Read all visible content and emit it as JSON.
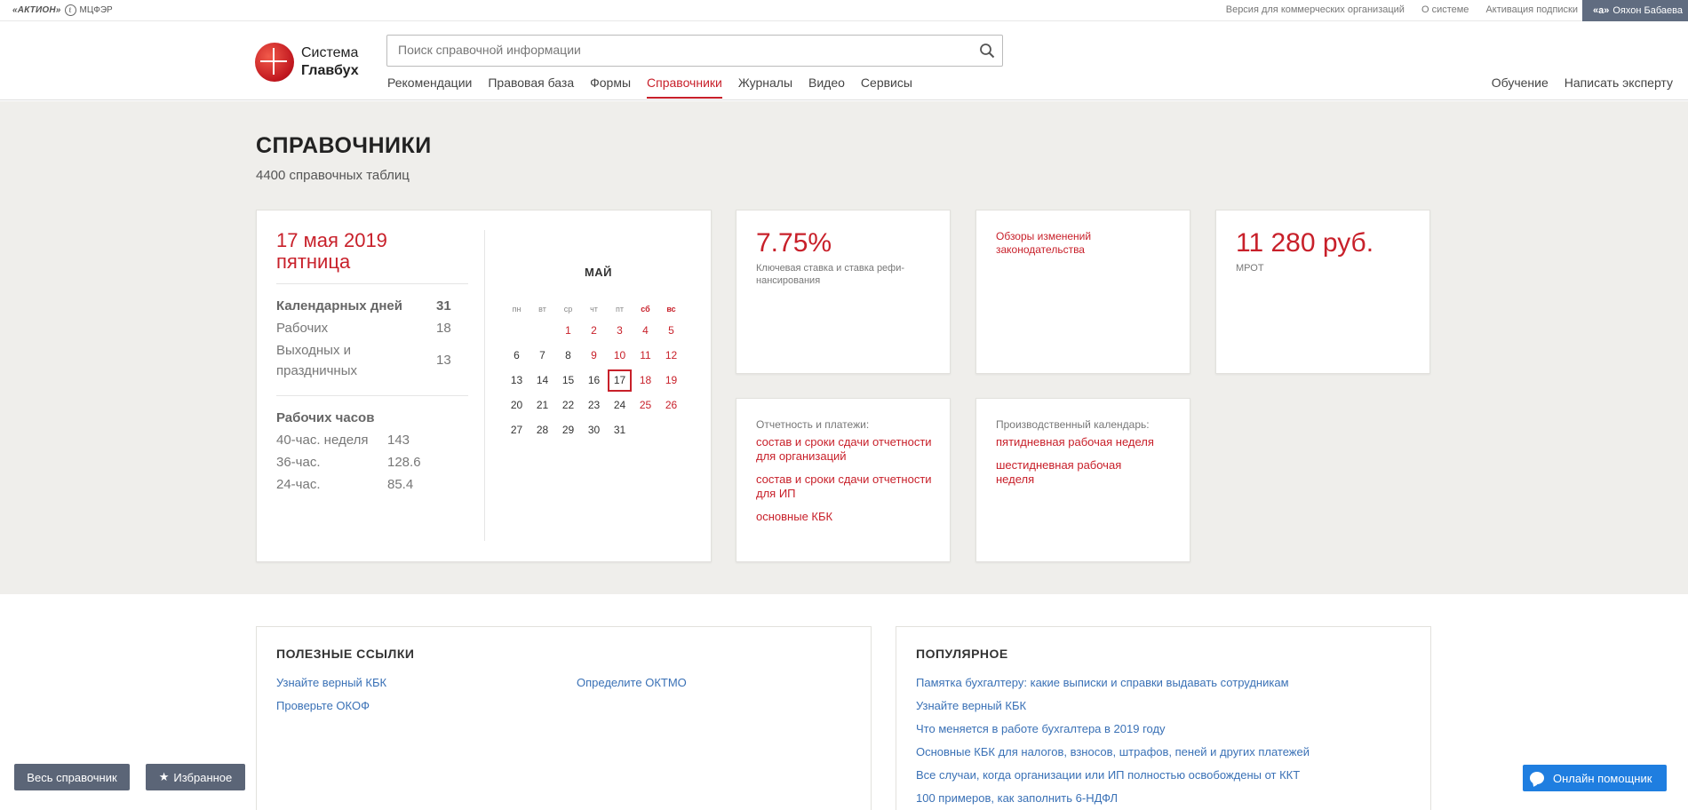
{
  "topbar": {
    "brand_aktion": "«АКТИОН»",
    "brand_mcfer": "МЦФЭР",
    "links": [
      "Версия для коммерческих организаций",
      "О системе",
      "Активация подписки"
    ],
    "user_icon": "«а»",
    "user_name": "Ояхон Бабаева"
  },
  "header": {
    "logo_line1": "Система",
    "logo_line2": "Главбух",
    "search_placeholder": "Поиск справочной информации",
    "nav": [
      "Рекомендации",
      "Правовая база",
      "Формы",
      "Справочники",
      "Журналы",
      "Видео",
      "Сервисы"
    ],
    "nav_active_index": 3,
    "nav_right": [
      "Обучение",
      "Написать эксперту"
    ]
  },
  "page": {
    "title": "СПРАВОЧНИКИ",
    "subtitle": "4400 справочных таблиц"
  },
  "date_card": {
    "date_line1": "17 мая 2019",
    "date_line2": "пятница",
    "calendar_days_label": "Календарных дней",
    "calendar_days_value": "31",
    "working_label": "Рабочих",
    "working_value": "18",
    "holidays_label": "Выходных и праздничных",
    "holidays_value": "13",
    "hours_label": "Рабочих часов",
    "hours": [
      {
        "label": "40-час. неделя",
        "value": "143"
      },
      {
        "label": "36-час.",
        "value": "128.6"
      },
      {
        "label": "24-час.",
        "value": "85.4"
      }
    ]
  },
  "calendar": {
    "month": "МАЙ",
    "weekdays": [
      "пн",
      "вт",
      "ср",
      "чт",
      "пт",
      "сб",
      "вс"
    ],
    "weeks": [
      [
        "",
        "",
        "1",
        "2",
        "3",
        "4",
        "5"
      ],
      [
        "6",
        "7",
        "8",
        "9",
        "10",
        "11",
        "12"
      ],
      [
        "13",
        "14",
        "15",
        "16",
        "17",
        "18",
        "19"
      ],
      [
        "20",
        "21",
        "22",
        "23",
        "24",
        "25",
        "26"
      ],
      [
        "27",
        "28",
        "29",
        "30",
        "31",
        "",
        ""
      ]
    ],
    "red_days": [
      "1",
      "2",
      "3",
      "4",
      "5",
      "9",
      "10",
      "11",
      "12",
      "18",
      "19",
      "25",
      "26"
    ],
    "today": "17"
  },
  "rate_card": {
    "value": "7.75%",
    "label": "Ключевая ставка и ставка рефи-нансирования"
  },
  "reviews_card": {
    "link": "Обзоры изменений законодательства"
  },
  "mrot_card": {
    "value": "11 280 руб.",
    "label": "МРОТ"
  },
  "reports_card": {
    "lead": "Отчетность и платежи:",
    "links": [
      "состав и сроки сдачи отчетности для организаций",
      "состав и сроки сдачи отчетности для ИП",
      "основные КБК"
    ]
  },
  "production_card": {
    "lead": "Производственный календарь:",
    "links": [
      "пятидневная рабочая неделя",
      "шестидневная рабочая неделя"
    ]
  },
  "useful": {
    "title": "ПОЛЕЗНЫЕ ССЫЛКИ",
    "col1": [
      "Узнайте верный КБК",
      "Проверьте ОКОФ"
    ],
    "col2": [
      "Определите ОКТМО"
    ]
  },
  "popular": {
    "title": "ПОПУЛЯРНОЕ",
    "links": [
      "Памятка бухгалтеру: какие выписки и справки выдавать сотрудникам",
      "Узнайте верный КБК",
      "Что меняется в работе бухгалтера в 2019 году",
      "Основные КБК для налогов, взносов, штрафов, пеней и других платежей",
      "Все случаи, когда организации или ИП полностью освобождены от ККТ",
      "100 примеров, как заполнить 6-НДФЛ"
    ]
  },
  "floating": {
    "all_ref": "Весь справочник",
    "favorites": "Избранное",
    "assistant": "Онлайн помощник"
  },
  "colors": {
    "accent_red": "#c8202a",
    "link_blue": "#3a71b6",
    "gray_bg": "#efeeeb",
    "assistant_blue": "#1f7ee0"
  }
}
